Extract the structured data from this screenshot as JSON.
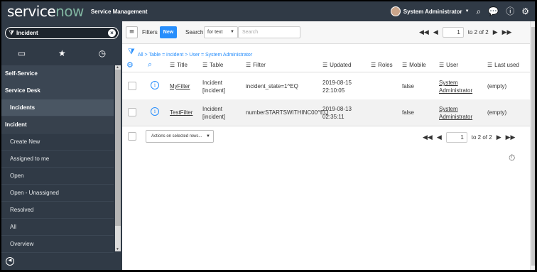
{
  "header": {
    "logo_pre": "service",
    "logo_now": "now",
    "app_title": "Service Management",
    "user_name": "System Administrator",
    "icons": [
      "search-icon",
      "chat-icon",
      "help-icon",
      "gear-icon"
    ]
  },
  "sidebar": {
    "filter_text": "Incident",
    "tabs": [
      "all-apps-icon",
      "favorites-star-icon",
      "history-clock-icon"
    ],
    "items": [
      {
        "label": "Self-Service",
        "kind": "section"
      },
      {
        "label": "Service Desk",
        "kind": "section"
      },
      {
        "label": "Incidents",
        "kind": "active"
      },
      {
        "label": "Incident",
        "kind": "module"
      },
      {
        "label": "Create New",
        "kind": "sub"
      },
      {
        "label": "Assigned to me",
        "kind": "sub"
      },
      {
        "label": "Open",
        "kind": "sub"
      },
      {
        "label": "Open - Unassigned",
        "kind": "sub"
      },
      {
        "label": "Resolved",
        "kind": "sub"
      },
      {
        "label": "All",
        "kind": "sub"
      },
      {
        "label": "Overview",
        "kind": "sub"
      }
    ]
  },
  "toolbar": {
    "filters_label": "Filters",
    "new_label": "New",
    "search_label": "Search",
    "search_field": "for text",
    "search_placeholder": "Search",
    "page_value": "1",
    "page_of": "to 2 of 2"
  },
  "breadcrumb": "All > Table = incident > User = System Administrator",
  "columns": {
    "title": "Title",
    "table": "Table",
    "filter": "Filter",
    "updated": "Updated",
    "roles": "Roles",
    "mobile": "Mobile",
    "user": "User",
    "last_used": "Last used"
  },
  "rows": [
    {
      "title": "MyFilter",
      "table_line1": "Incident",
      "table_line2": "[incident]",
      "filter": "incident_state=1^EQ",
      "updated_date": "2019-08-15",
      "updated_time": "22:10:05",
      "roles": "",
      "mobile": "false",
      "user_line1": "System",
      "user_line2": "Administrator",
      "last_used": "(empty)"
    },
    {
      "title": "TestFilter",
      "table_line1": "Incident",
      "table_line2": "[incident]",
      "filter": "numberSTARTSWITHINC00^EQ",
      "updated_date": "2019-08-13",
      "updated_time": "02:35:11",
      "roles": "",
      "mobile": "false",
      "user_line1": "System",
      "user_line2": "Administrator",
      "last_used": "(empty)"
    }
  ],
  "footer": {
    "actions_label": "Actions on selected rows...",
    "page_value": "1",
    "page_of": "to 2 of 2"
  },
  "colors": {
    "header_bg": "#303a46",
    "accent": "#278efc",
    "logo_green": "#81b5a1"
  }
}
